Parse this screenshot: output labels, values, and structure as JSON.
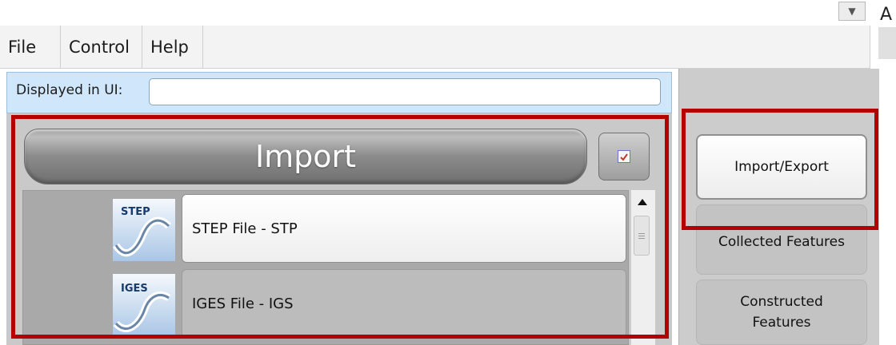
{
  "top_combo": {
    "dropdown_glyph": "▼"
  },
  "corner_letter": "A",
  "menu": {
    "items": [
      {
        "label": "File"
      },
      {
        "label": "Control"
      },
      {
        "label": "Help"
      }
    ]
  },
  "display_bar": {
    "label": "Displayed in UI:",
    "value": ""
  },
  "import_panel": {
    "title": "Import",
    "check_icon": "checklist-icon",
    "items": [
      {
        "icon_text": "STEP",
        "icon": "step-file-icon",
        "label": "STEP File - STP",
        "selected": true
      },
      {
        "icon_text": "IGES",
        "icon": "iges-file-icon",
        "label": "IGES File - IGS",
        "selected": false
      }
    ]
  },
  "side_nav": {
    "items": [
      {
        "label": "Import/Export",
        "active": true
      },
      {
        "label": "Collected Features",
        "active": false
      },
      {
        "label": "Constructed Features",
        "active": false
      }
    ]
  },
  "colors": {
    "highlight": "#b50000",
    "display_bar_bg": "#cfe6fb",
    "panel_gray": "#c9c9c9"
  }
}
